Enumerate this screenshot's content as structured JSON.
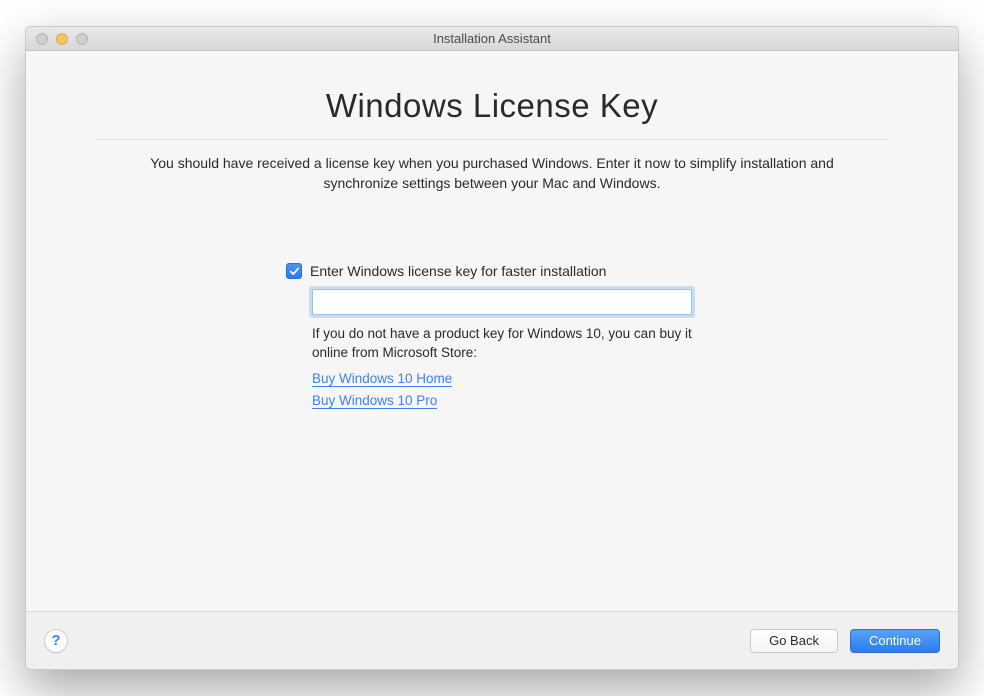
{
  "window": {
    "title": "Installation Assistant"
  },
  "page": {
    "title": "Windows License Key",
    "description": "You should have received a license key when you purchased Windows. Enter it now to simplify installation and synchronize settings between your Mac and Windows."
  },
  "form": {
    "checkbox_label": "Enter Windows license key for faster installation",
    "checkbox_checked": true,
    "license_value": "",
    "hint": "If you do not have a product key for Windows 10, you can buy it online from Microsoft Store:",
    "links": {
      "home": "Buy Windows 10 Home",
      "pro": "Buy Windows 10 Pro"
    }
  },
  "footer": {
    "help_label": "?",
    "back_label": "Go Back",
    "continue_label": "Continue"
  }
}
